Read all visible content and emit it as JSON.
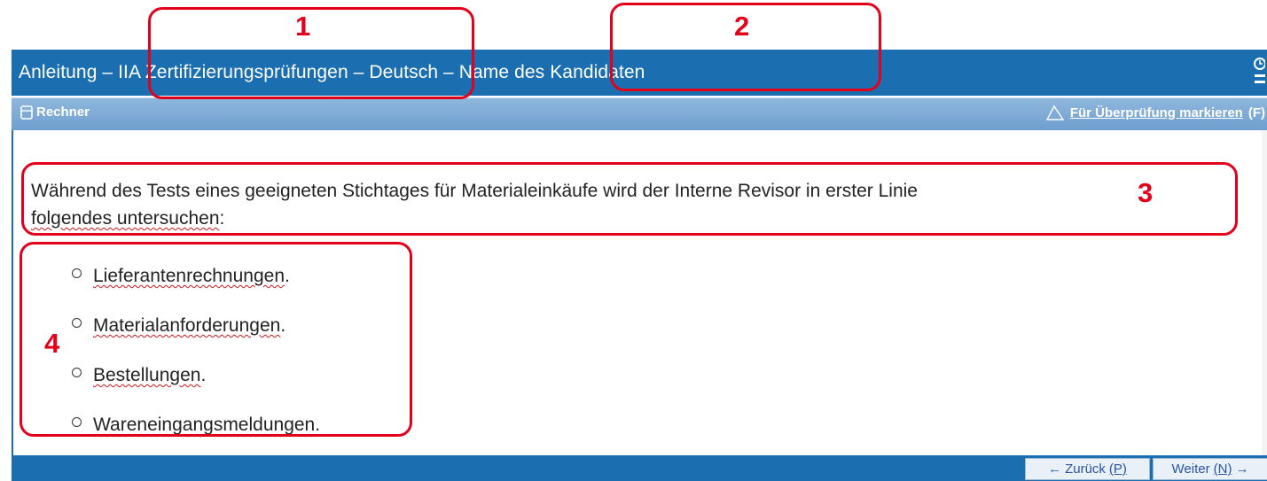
{
  "header": {
    "title": "Anleitung – IIA Zertifizierungsprüfungen – Deutsch – Name des Kandidaten"
  },
  "toolbar": {
    "calculator_label": "Rechner",
    "flag_label": "Für Überprüfung markieren",
    "flag_shortcut": "(F)"
  },
  "question": {
    "text_main": "Während des Tests eines geeigneten Stichtages für Materialeinkäufe wird der Interne Revisor in erster Linie",
    "text_underlined": "folgendes untersuchen",
    "text_end": ":"
  },
  "options": [
    {
      "label": "Lieferantenrechnungen",
      "punct": "."
    },
    {
      "label": "Materialanforderungen",
      "punct": "."
    },
    {
      "label": "Bestellungen",
      "punct": "."
    },
    {
      "label": "Wareneingangsmeldungen",
      "punct": "."
    }
  ],
  "footer": {
    "back_label": "Zurück",
    "back_shortcut": "(P)",
    "next_label": "Weiter",
    "next_shortcut": "(N)"
  },
  "annotations": {
    "label_1": "1",
    "label_2": "2",
    "label_3": "3",
    "label_4": "4",
    "color": "#e3001b"
  },
  "colors": {
    "title_bar": "#1b6fb0",
    "toolbar": "#7aa8d6",
    "text": "#222222"
  },
  "icons": {
    "calculator": "calculator-icon",
    "flag": "flag-icon",
    "clock": "clock-icon",
    "back_arrow": "arrow-left-icon",
    "next_arrow": "arrow-right-icon"
  }
}
